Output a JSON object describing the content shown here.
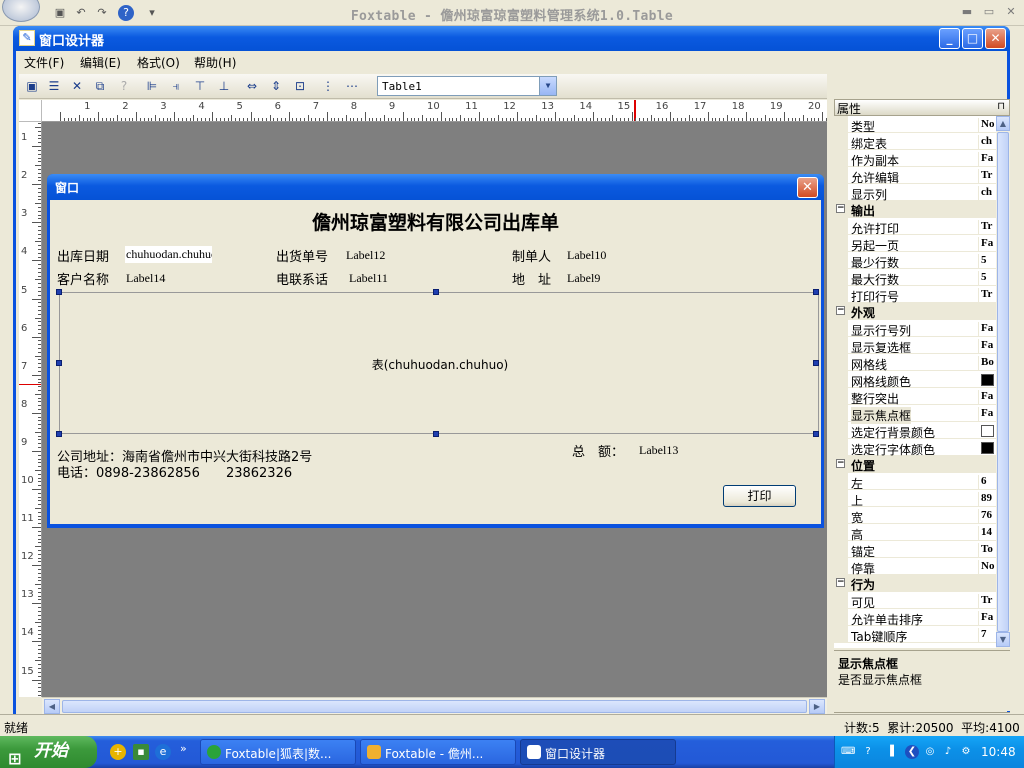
{
  "app": {
    "title": "Foxtable - 儋州琼富琼富塑料管理系统1.0.Table"
  },
  "dialog": {
    "title": "窗口设计器",
    "minimize_glyph": "_",
    "maximize_glyph": "□",
    "close_glyph": "✕"
  },
  "menu": [
    {
      "label": "文件(F)"
    },
    {
      "label": "编辑(E)"
    },
    {
      "label": "格式(O)"
    },
    {
      "label": "帮助(H)"
    }
  ],
  "toolbar": {
    "icons": [
      "save-icon",
      "properties-icon",
      "delete-icon",
      "copy-icon",
      "help-icon",
      "align-left-icon",
      "align-right-icon",
      "align-top-icon",
      "align-bottom-icon",
      "same-width-icon",
      "same-height-icon",
      "same-size-icon",
      "center-vertical-icon",
      "spacing-icon"
    ],
    "table_select_value": "Table1"
  },
  "ruler": {
    "h_numbers": [
      "1",
      "2",
      "3",
      "4",
      "5",
      "6",
      "7",
      "8",
      "9",
      "10",
      "11",
      "12",
      "13",
      "14",
      "15",
      "16",
      "17",
      "18",
      "19",
      "20"
    ],
    "v_numbers": [
      "1",
      "2",
      "3",
      "4",
      "5",
      "6",
      "7",
      "8",
      "9",
      "10",
      "11",
      "12",
      "13",
      "14",
      "15"
    ]
  },
  "form": {
    "title": "窗口",
    "close_glyph": "✕",
    "heading": "儋州琼富塑料有限公司出库单",
    "labels": {
      "out_date": "出库日期",
      "out_date_value": "chuhuodan.chuhuoriqi",
      "order_no": "出货单号",
      "order_no_value": "Label12",
      "creator": "制单人",
      "creator_value": "Label10",
      "customer": "客户名称",
      "customer_value": "Label14",
      "phone": "电联系话",
      "phone_value": "Label11",
      "address": "地　址",
      "address_value": "Label9",
      "company_address": "公司地址：海南省儋州市中兴大街科技路2号",
      "company_phone": "电话：0898-23862856　　23862326",
      "total": "总　额：",
      "total_value": "Label13"
    },
    "grid_caption": "表(chuhuodan.chuhuo)",
    "print_button": "打印"
  },
  "properties": {
    "header": "属性",
    "pin_glyph": "⊓",
    "rows": [
      {
        "kind": "prop",
        "name": "类型",
        "value": "No"
      },
      {
        "kind": "prop",
        "name": "绑定表",
        "value": "ch"
      },
      {
        "kind": "prop",
        "name": "作为副本",
        "value": "Fa"
      },
      {
        "kind": "prop",
        "name": "允许编辑",
        "value": "Tr"
      },
      {
        "kind": "prop",
        "name": "显示列",
        "value": "ch"
      },
      {
        "kind": "cat",
        "name": "输出",
        "toggle": "−"
      },
      {
        "kind": "prop",
        "name": "允许打印",
        "value": "Tr"
      },
      {
        "kind": "prop",
        "name": "另起一页",
        "value": "Fa"
      },
      {
        "kind": "prop",
        "name": "最少行数",
        "value": "5"
      },
      {
        "kind": "prop",
        "name": "最大行数",
        "value": "5"
      },
      {
        "kind": "prop",
        "name": "打印行号",
        "value": "Tr"
      },
      {
        "kind": "cat",
        "name": "外观",
        "toggle": "−"
      },
      {
        "kind": "prop",
        "name": "显示行号列",
        "value": "Fa"
      },
      {
        "kind": "prop",
        "name": "显示复选框",
        "value": "Fa"
      },
      {
        "kind": "prop",
        "name": "网格线",
        "value": "Bo"
      },
      {
        "kind": "prop",
        "name": "网格线颜色",
        "value": "",
        "swatch": "#000000"
      },
      {
        "kind": "prop",
        "name": "整行突出",
        "value": "Fa"
      },
      {
        "kind": "prop",
        "name": "显示焦点框",
        "value": "Fa",
        "selected": true
      },
      {
        "kind": "prop",
        "name": "选定行背景颜色",
        "value": "",
        "swatch": "#ffffff"
      },
      {
        "kind": "prop",
        "name": "选定行字体颜色",
        "value": "",
        "swatch": "#000000"
      },
      {
        "kind": "cat",
        "name": "位置",
        "toggle": "−"
      },
      {
        "kind": "prop",
        "name": "左",
        "value": "6"
      },
      {
        "kind": "prop",
        "name": "上",
        "value": "89"
      },
      {
        "kind": "prop",
        "name": "宽",
        "value": "76"
      },
      {
        "kind": "prop",
        "name": "高",
        "value": "14"
      },
      {
        "kind": "prop",
        "name": "锚定",
        "value": "To"
      },
      {
        "kind": "prop",
        "name": "停靠",
        "value": "No"
      },
      {
        "kind": "cat",
        "name": "行为",
        "toggle": "−"
      },
      {
        "kind": "prop",
        "name": "可见",
        "value": "Tr"
      },
      {
        "kind": "prop",
        "name": "允许单击排序",
        "value": "Fa"
      },
      {
        "kind": "prop",
        "name": "Tab键顺序",
        "value": "7"
      }
    ],
    "desc_title": "显示焦点框",
    "desc_text": "是否显示焦点框",
    "tabs": [
      "categorized-icon",
      "properties-page-icon",
      "events-icon",
      "pages-icon"
    ]
  },
  "status": {
    "left": "就绪",
    "right": "计数:5  累计:20500  平均:4100"
  },
  "taskbar": {
    "start": "开始",
    "tasks": [
      {
        "label": "Foxtable|狐表|数...",
        "active": false
      },
      {
        "label": "Foxtable - 儋州...",
        "active": false
      },
      {
        "label": "窗口设计器",
        "active": true
      }
    ],
    "clock": "10:48"
  }
}
